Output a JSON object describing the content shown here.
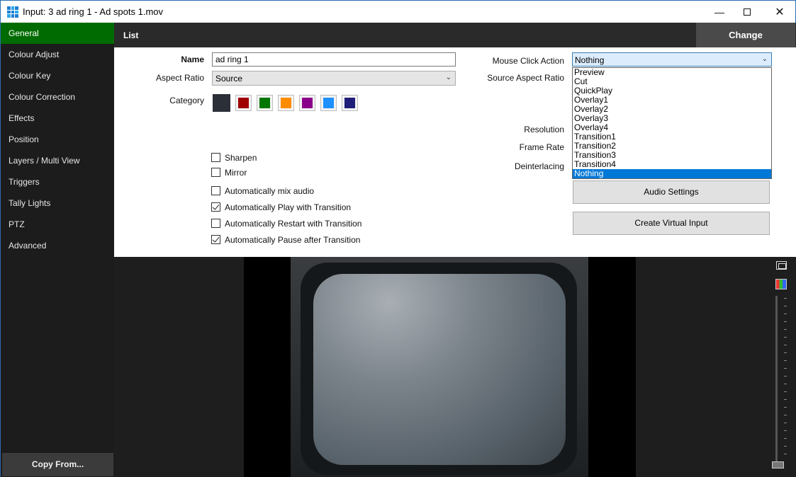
{
  "window": {
    "title": "Input: 3 ad ring 1 - Ad spots 1.mov",
    "minimize_icon": "minimize-icon",
    "maximize_icon": "maximize-icon",
    "close_icon": "close-icon"
  },
  "sidebar": {
    "items": [
      {
        "label": "General",
        "active": true
      },
      {
        "label": "Colour Adjust"
      },
      {
        "label": "Colour Key"
      },
      {
        "label": "Colour Correction"
      },
      {
        "label": "Effects"
      },
      {
        "label": "Position"
      },
      {
        "label": "Layers / Multi View"
      },
      {
        "label": "Triggers"
      },
      {
        "label": "Tally Lights"
      },
      {
        "label": "PTZ"
      },
      {
        "label": "Advanced"
      }
    ],
    "copy_from": "Copy From..."
  },
  "topbar": {
    "list_label": "List",
    "change_label": "Change"
  },
  "form": {
    "name_label": "Name",
    "name_value": "ad ring 1",
    "aspect_label": "Aspect Ratio",
    "aspect_value": "Source",
    "category_label": "Category",
    "category_colors": [
      "#2b3038",
      "#a00000",
      "#007700",
      "#ff8c00",
      "#8b008b",
      "#1e90ff",
      "#1f1f7a"
    ],
    "mouse_click_label": "Mouse Click Action",
    "mouse_click_value": "Nothing",
    "source_aspect_label": "Source Aspect Ratio",
    "resolution_label": "Resolution",
    "frame_rate_label": "Frame Rate",
    "deinterlacing_label": "Deinterlacing",
    "checkboxes": [
      {
        "label": "Sharpen",
        "checked": false
      },
      {
        "label": "Mirror",
        "checked": false
      },
      {
        "label": "Automatically mix audio",
        "checked": false
      },
      {
        "label": "Automatically Play with Transition",
        "checked": true
      },
      {
        "label": "Automatically Restart with Transition",
        "checked": false
      },
      {
        "label": "Automatically Pause after Transition",
        "checked": true
      }
    ],
    "audio_settings": "Audio Settings",
    "create_virtual_input": "Create Virtual Input"
  },
  "dropdown": {
    "options": [
      "Preview",
      "Cut",
      "QuickPlay",
      "Overlay1",
      "Overlay2",
      "Overlay3",
      "Overlay4",
      "Transition1",
      "Transition2",
      "Transition3",
      "Transition4",
      "Nothing"
    ],
    "selected": "Nothing"
  }
}
